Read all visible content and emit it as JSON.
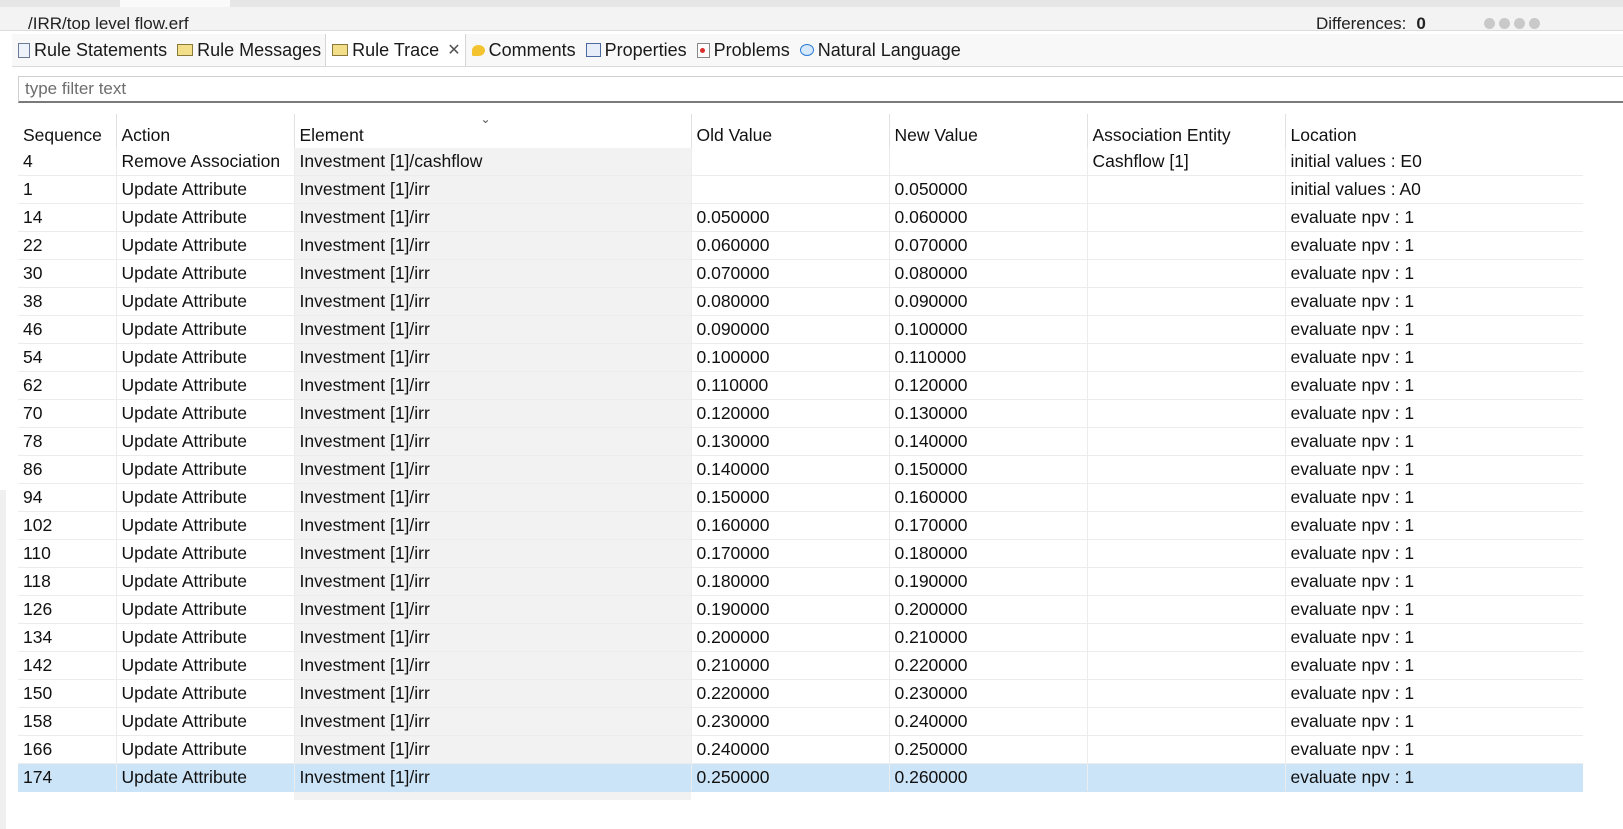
{
  "compare_bar": {
    "path": "/IRR/top level flow.erf",
    "differences_label": "Differences:",
    "differences_count": "0"
  },
  "tabs": [
    {
      "label": "Rule Statements",
      "icon": "document-icon"
    },
    {
      "label": "Rule Messages",
      "icon": "envelope-icon"
    },
    {
      "label": "Rule Trace",
      "icon": "envelope-icon",
      "active": true
    },
    {
      "label": "Comments",
      "icon": "comment-icon"
    },
    {
      "label": "Properties",
      "icon": "properties-icon"
    },
    {
      "label": "Problems",
      "icon": "problems-icon"
    },
    {
      "label": "Natural Language",
      "icon": "speech-bubble-icon"
    }
  ],
  "close_glyph": "✕",
  "filter": {
    "placeholder": "type filter text",
    "value": ""
  },
  "table": {
    "columns": [
      "Sequence",
      "Action",
      "Element",
      "Old Value",
      "New Value",
      "Association Entity",
      "Location"
    ],
    "sort_glyph": "⌄",
    "rows": [
      [
        "4",
        "Remove Association",
        "Investment [1]/cashflow",
        "",
        "",
        "Cashflow [1]",
        "initial values : E0"
      ],
      [
        "1",
        "Update Attribute",
        "Investment [1]/irr",
        "",
        "0.050000",
        "",
        "initial values : A0"
      ],
      [
        "14",
        "Update Attribute",
        "Investment [1]/irr",
        "0.050000",
        "0.060000",
        "",
        "evaluate npv : 1"
      ],
      [
        "22",
        "Update Attribute",
        "Investment [1]/irr",
        "0.060000",
        "0.070000",
        "",
        "evaluate npv : 1"
      ],
      [
        "30",
        "Update Attribute",
        "Investment [1]/irr",
        "0.070000",
        "0.080000",
        "",
        "evaluate npv : 1"
      ],
      [
        "38",
        "Update Attribute",
        "Investment [1]/irr",
        "0.080000",
        "0.090000",
        "",
        "evaluate npv : 1"
      ],
      [
        "46",
        "Update Attribute",
        "Investment [1]/irr",
        "0.090000",
        "0.100000",
        "",
        "evaluate npv : 1"
      ],
      [
        "54",
        "Update Attribute",
        "Investment [1]/irr",
        "0.100000",
        "0.110000",
        "",
        "evaluate npv : 1"
      ],
      [
        "62",
        "Update Attribute",
        "Investment [1]/irr",
        "0.110000",
        "0.120000",
        "",
        "evaluate npv : 1"
      ],
      [
        "70",
        "Update Attribute",
        "Investment [1]/irr",
        "0.120000",
        "0.130000",
        "",
        "evaluate npv : 1"
      ],
      [
        "78",
        "Update Attribute",
        "Investment [1]/irr",
        "0.130000",
        "0.140000",
        "",
        "evaluate npv : 1"
      ],
      [
        "86",
        "Update Attribute",
        "Investment [1]/irr",
        "0.140000",
        "0.150000",
        "",
        "evaluate npv : 1"
      ],
      [
        "94",
        "Update Attribute",
        "Investment [1]/irr",
        "0.150000",
        "0.160000",
        "",
        "evaluate npv : 1"
      ],
      [
        "102",
        "Update Attribute",
        "Investment [1]/irr",
        "0.160000",
        "0.170000",
        "",
        "evaluate npv : 1"
      ],
      [
        "110",
        "Update Attribute",
        "Investment [1]/irr",
        "0.170000",
        "0.180000",
        "",
        "evaluate npv : 1"
      ],
      [
        "118",
        "Update Attribute",
        "Investment [1]/irr",
        "0.180000",
        "0.190000",
        "",
        "evaluate npv : 1"
      ],
      [
        "126",
        "Update Attribute",
        "Investment [1]/irr",
        "0.190000",
        "0.200000",
        "",
        "evaluate npv : 1"
      ],
      [
        "134",
        "Update Attribute",
        "Investment [1]/irr",
        "0.200000",
        "0.210000",
        "",
        "evaluate npv : 1"
      ],
      [
        "142",
        "Update Attribute",
        "Investment [1]/irr",
        "0.210000",
        "0.220000",
        "",
        "evaluate npv : 1"
      ],
      [
        "150",
        "Update Attribute",
        "Investment [1]/irr",
        "0.220000",
        "0.230000",
        "",
        "evaluate npv : 1"
      ],
      [
        "158",
        "Update Attribute",
        "Investment [1]/irr",
        "0.230000",
        "0.240000",
        "",
        "evaluate npv : 1"
      ],
      [
        "166",
        "Update Attribute",
        "Investment [1]/irr",
        "0.240000",
        "0.250000",
        "",
        "evaluate npv : 1"
      ],
      [
        "174",
        "Update Attribute",
        "Investment [1]/irr",
        "0.250000",
        "0.260000",
        "",
        "evaluate npv : 1"
      ]
    ],
    "selected_row": 22
  },
  "colors": {
    "selection": "#cce4f7",
    "element_column_bg": "#f2f2f2"
  }
}
